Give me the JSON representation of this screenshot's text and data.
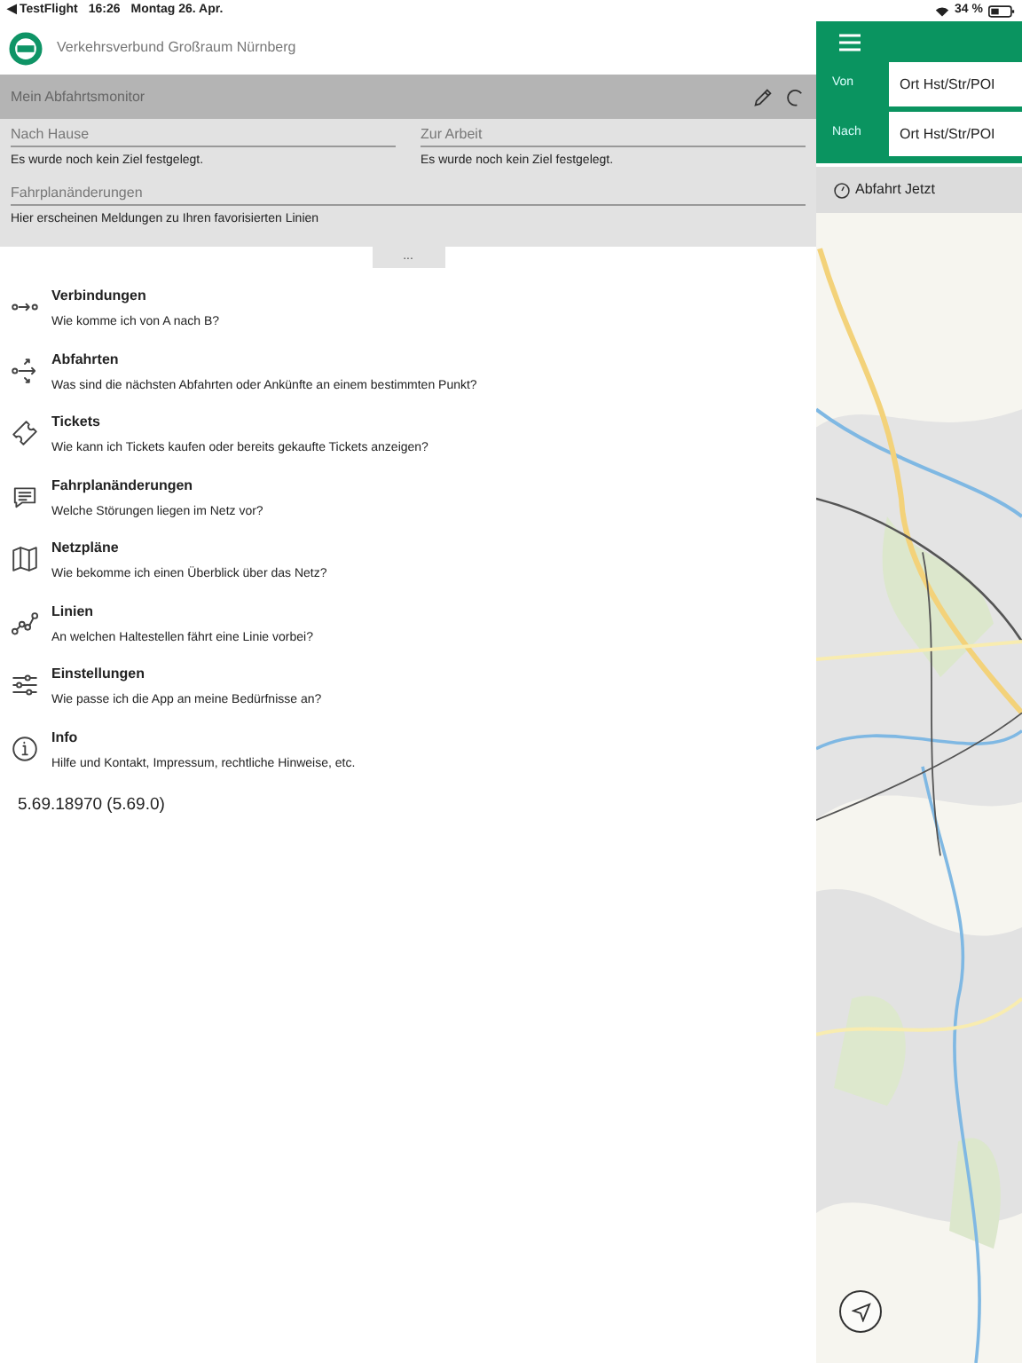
{
  "status_bar": {
    "back": "◀ TestFlight",
    "time": "16:26",
    "date": "Montag 26. Apr.",
    "battery": "34 %"
  },
  "header": {
    "title": "Verkehrsverbund Großraum Nürnberg"
  },
  "monitor": {
    "title": "Mein Abfahrtsmonitor",
    "favorites": [
      {
        "label": "Nach Hause",
        "text": "Es wurde noch kein Ziel festgelegt."
      },
      {
        "label": "Zur Arbeit",
        "text": "Es wurde noch kein Ziel festgelegt."
      }
    ],
    "changes": {
      "label": "Fahrplanänderungen",
      "text": "Hier erscheinen Meldungen zu Ihren favorisierten Linien"
    },
    "more": "..."
  },
  "menu": [
    {
      "kind": "connections",
      "title": "Verbindungen",
      "subtitle": "Wie komme ich von A nach B?"
    },
    {
      "kind": "departures",
      "title": "Abfahrten",
      "subtitle": "Was sind die nächsten Abfahrten oder Ankünfte an einem bestimmten Punkt?"
    },
    {
      "kind": "tickets",
      "title": "Tickets",
      "subtitle": "Wie kann ich Tickets kaufen oder bereits gekaufte Tickets anzeigen?"
    },
    {
      "kind": "messages",
      "title": "Fahrplanänderungen",
      "subtitle": "Welche Störungen liegen im Netz vor?"
    },
    {
      "kind": "map",
      "title": "Netzpläne",
      "subtitle": "Wie bekomme ich einen Überblick über das Netz?"
    },
    {
      "kind": "lines",
      "title": "Linien",
      "subtitle": "An welchen Haltestellen fährt eine Linie vorbei?"
    },
    {
      "kind": "settings",
      "title": "Einstellungen",
      "subtitle": "Wie passe ich die App an meine Bedürfnisse an?"
    },
    {
      "kind": "info",
      "title": "Info",
      "subtitle": "Hilfe und Kontakt, Impressum, rechtliche Hinweise, etc."
    }
  ],
  "version": "5.69.18970 (5.69.0)",
  "trip": {
    "fields": [
      {
        "label": "Von",
        "value": "Ort Hst/Str/POI"
      },
      {
        "label": "Nach",
        "value": "Ort Hst/Str/POI"
      }
    ],
    "time": "Abfahrt Jetzt"
  }
}
